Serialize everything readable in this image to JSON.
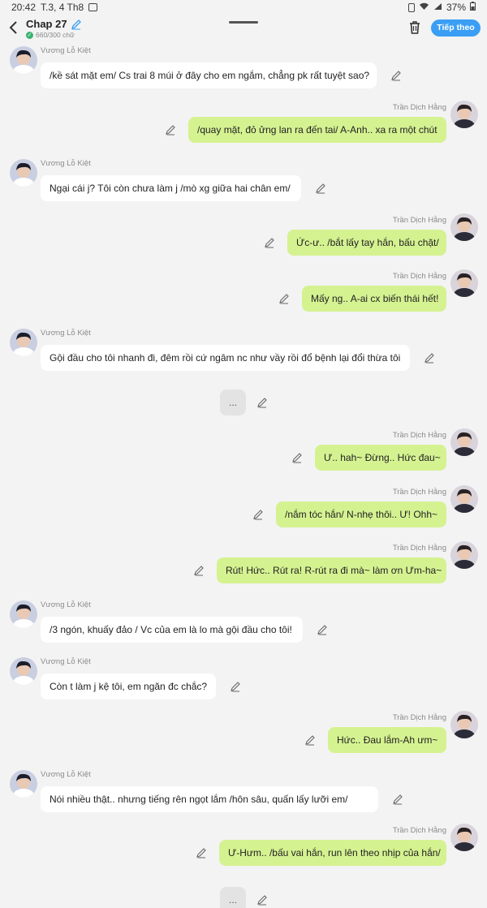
{
  "status_bar": {
    "time": "20:42",
    "date": "T.3, 4 Th8",
    "battery": "37%"
  },
  "header": {
    "title": "Chap 27",
    "word_count": "660/300 chữ",
    "next_label": "Tiếp theo"
  },
  "colors": {
    "accent": "#3a9ef5",
    "bubble_right": "#d5f291",
    "bubble_left": "#ffffff",
    "background": "#f3f3f3"
  },
  "messages": [
    {
      "side": "left",
      "name": "Vương Lỗ Kiệt",
      "text": "/kề sát mặt em/ Cs trai 8 múi ở đây cho em ngắm, chẳng pk rất tuyệt sao?"
    },
    {
      "side": "right",
      "name": "Trần Dịch Hằng",
      "text": "/quay mặt, đỏ ửng lan ra đến tai/ A-Anh.. xa ra một chút"
    },
    {
      "side": "left",
      "name": "Vương Lỗ Kiệt",
      "text": "Ngại cái j? Tôi còn chưa làm j /mò xg giữa hai chân em/"
    },
    {
      "side": "right",
      "name": "Trần Dịch Hằng",
      "text": "Ức-ư.. /bắt lấy tay hắn, bấu chặt/"
    },
    {
      "side": "right",
      "name": "Trần Dịch Hằng",
      "text": "Mấy ng.. A-ai cx biến thái hết!"
    },
    {
      "side": "left",
      "name": "Vương Lỗ Kiệt",
      "text": "Gội đầu cho tôi nhanh đi, đêm rồi cứ ngâm nc như vầy rồi đổ bệnh lại đổi thừa tôi"
    },
    {
      "side": "center",
      "name": "",
      "text": "..."
    },
    {
      "side": "right",
      "name": "Trần Dịch Hằng",
      "text": "Ư.. hah~ Đừng.. Hức đau~"
    },
    {
      "side": "right",
      "name": "Trần Dịch Hằng",
      "text": "/nắm tóc hắn/ N-nhẹ thôi.. Ư! Ohh~"
    },
    {
      "side": "right",
      "name": "Trần Dịch Hằng",
      "text": "Rút! Hức.. Rút ra! R-rút ra đi mà~ làm ơn Ưm-ha~"
    },
    {
      "side": "left",
      "name": "Vương Lỗ Kiệt",
      "text": "/3 ngón, khuấy đảo / Vc của em là lo mà gội đầu cho tôi!"
    },
    {
      "side": "left",
      "name": "Vương Lỗ Kiệt",
      "text": "Còn t làm j kệ tôi, em ngăn đc chắc?"
    },
    {
      "side": "right",
      "name": "Trần Dịch Hằng",
      "text": "Hức.. Đau lắm-Ah ưm~"
    },
    {
      "side": "left",
      "name": "Vương Lỗ Kiệt",
      "text": "Nói nhiều thật.. nhưng tiếng rên ngọt lắm /hôn sâu, quấn lấy lưỡi em/"
    },
    {
      "side": "right",
      "name": "Trần Dịch Hằng",
      "text": "Ư-Hưm.. /bấu vai hắn, run lên theo nhịp của hắn/"
    },
    {
      "side": "center",
      "name": "",
      "text": "..."
    }
  ]
}
